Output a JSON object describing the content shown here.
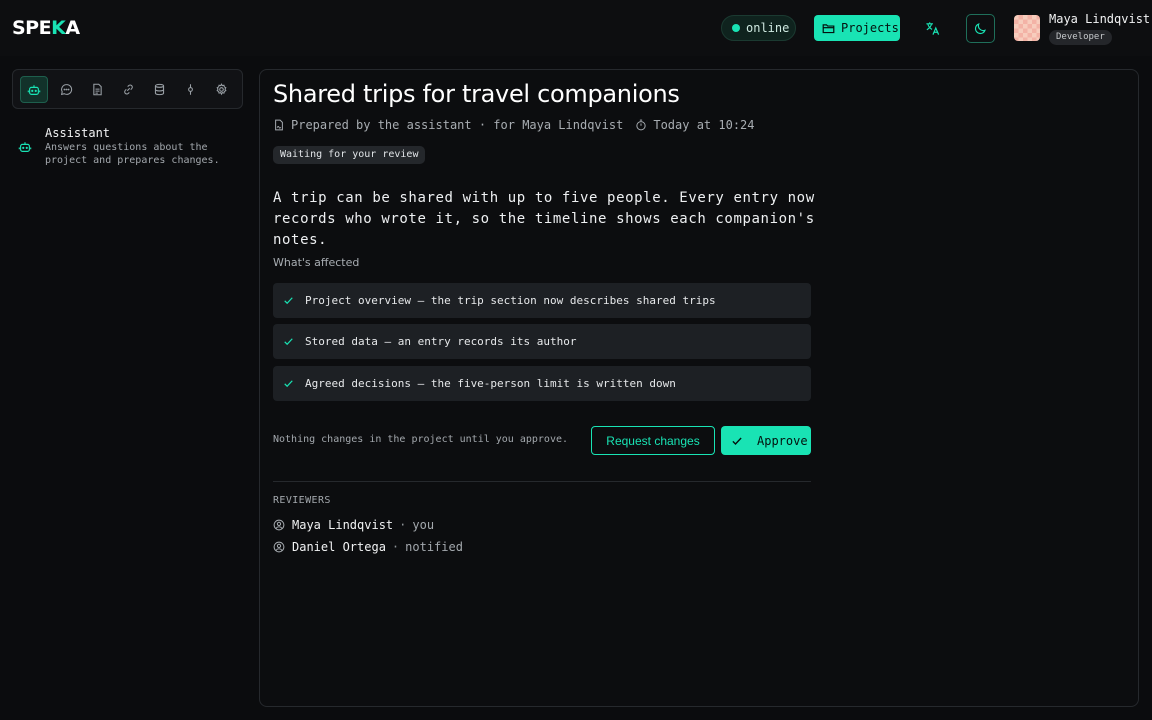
{
  "header": {
    "logo_left": "SPE",
    "logo_accent": "K",
    "logo_right": "A",
    "status_label": "online",
    "projects_label": "Projects",
    "user_name": "Maya Lindqvist",
    "user_role": "Developer"
  },
  "sidebar": {
    "tools": [
      {
        "icon": "robot-icon",
        "active": true
      },
      {
        "icon": "chat-icon"
      },
      {
        "icon": "document-icon"
      },
      {
        "icon": "link-icon"
      },
      {
        "icon": "database-icon"
      },
      {
        "icon": "commit-icon"
      },
      {
        "icon": "gear-icon"
      }
    ],
    "assistant": {
      "title": "Assistant",
      "description": "Answers questions about the project and prepares changes."
    }
  },
  "main": {
    "title": "Shared trips for travel companions",
    "prepared_by": "Prepared by the assistant · for Maya Lindqvist",
    "timestamp": "Today at 10:24",
    "status": "Waiting for your review",
    "summary": "A trip can be shared with up to five people. Every entry now records who wrote it, so the timeline shows each companion's notes.",
    "affected_heading": "What's affected",
    "affected": [
      "Project overview — the trip section now describes shared trips",
      "Stored data — an entry records its author",
      "Agreed decisions — the five-person limit is written down"
    ],
    "notice": "Nothing changes in the project until you approve.",
    "request_changes_label": "Request changes",
    "approve_label": "Approve",
    "reviewers_heading": "REVIEWERS",
    "reviewers": [
      {
        "name": "Maya Lindqvist",
        "note": "you"
      },
      {
        "name": "Daniel Ortega",
        "note": "notified"
      }
    ]
  },
  "colors": {
    "accent": "#19e3b4",
    "background": "#0b0c0e",
    "row_background": "#1d2024"
  }
}
